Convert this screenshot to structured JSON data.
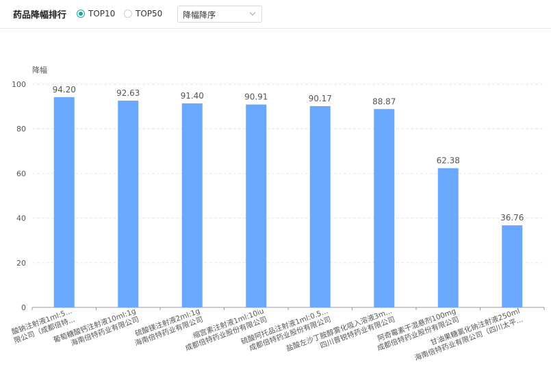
{
  "header": {
    "title": "药品降幅排行",
    "radio_top10": "TOP10",
    "radio_top50": "TOP50",
    "selected_radio": "TOP10",
    "sort_select": "降幅降序"
  },
  "colors": {
    "bar": "#6aa7fe",
    "accent": "#1aa79a"
  },
  "chart_data": {
    "type": "bar",
    "ylabel": "降幅",
    "ylim": [
      0,
      100
    ],
    "yticks": [
      0,
      20,
      40,
      60,
      80,
      100
    ],
    "grid": true,
    "categories": [
      {
        "line1": "酸钠注射液1ml:5...",
        "line2": "限公司（成都倍特..."
      },
      {
        "line1": "葡萄糖酸钙注射液10ml:1g",
        "line2": "海南倍特药业有限公司"
      },
      {
        "line1": "硫酸镁注射液2ml:1g",
        "line2": "海南倍特药业有限公司"
      },
      {
        "line1": "缩宫素注射液1ml:10iu",
        "line2": "成都倍特药业股份有限公司"
      },
      {
        "line1": "硫酸阿托品注射液1ml:0.5...",
        "line2": "成都倍特药业股份有限公司"
      },
      {
        "line1": "盐酸左沙丁胺醇雾化吸入溶液3m...",
        "line2": "四川普锐特药业有限公司"
      },
      {
        "line1": "阿奇霉素干混悬剂100mg",
        "line2": "成都倍特药业股份有限公司"
      },
      {
        "line1": "甘油果糖氯化钠注射液250ml",
        "line2": "海南倍特药业有限公司（四川太平..."
      }
    ],
    "values": [
      94.2,
      92.63,
      91.4,
      90.91,
      90.17,
      88.87,
      62.38,
      36.76
    ],
    "value_labels": [
      "94.20",
      "92.63",
      "91.40",
      "90.91",
      "90.17",
      "88.87",
      "62.38",
      "36.76"
    ]
  }
}
